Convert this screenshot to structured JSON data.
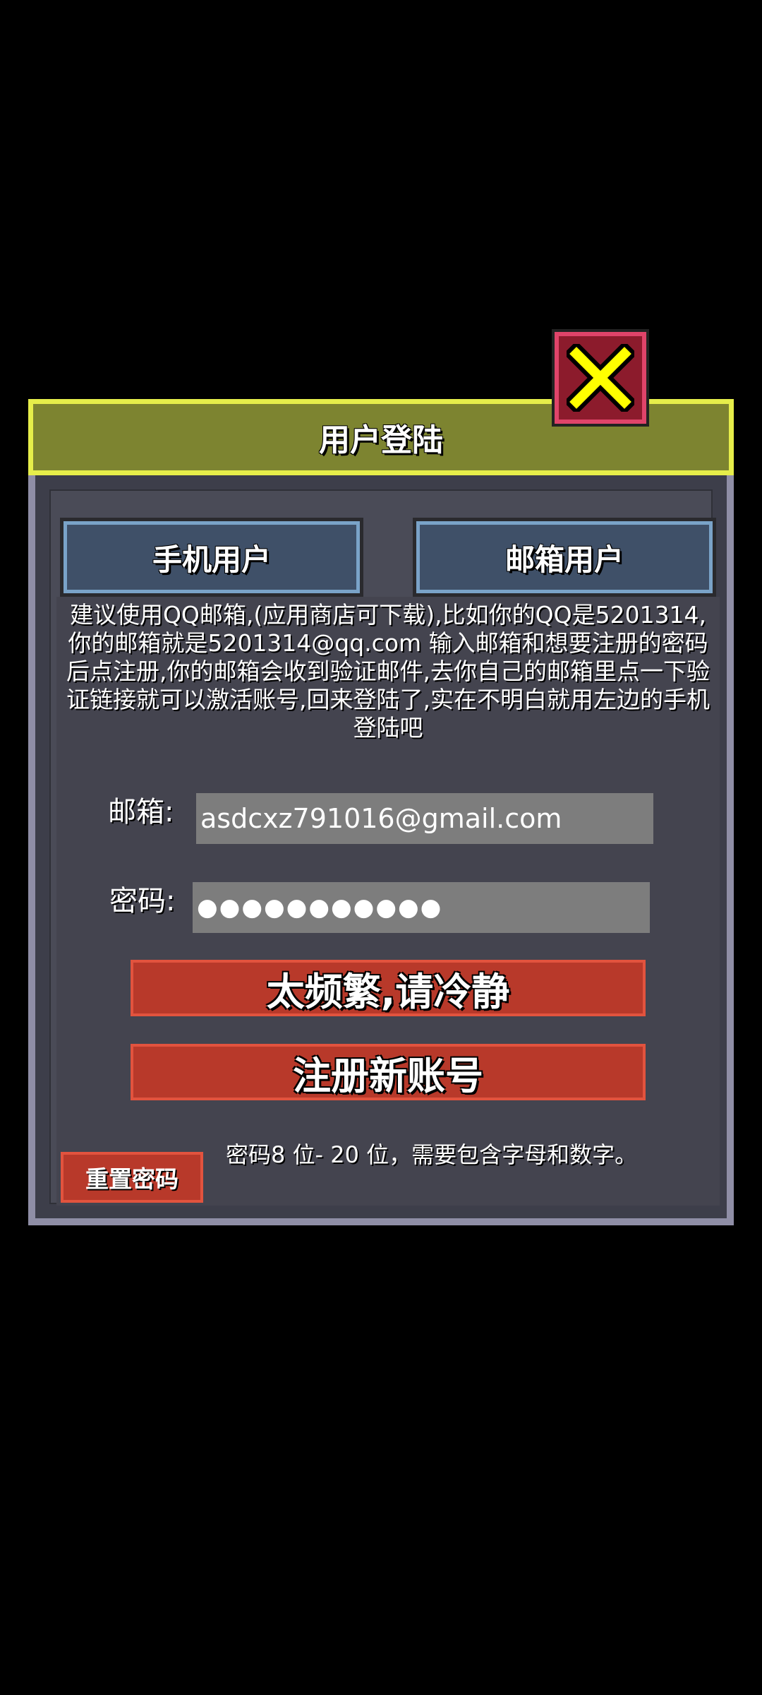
{
  "dialog": {
    "title": "用户登陆",
    "close_icon": "close-x-icon",
    "colors": {
      "title_bg": "#7d8430",
      "title_border": "#e6ee4a",
      "close_bg": "#8c1b2c",
      "close_x": "#ffff00",
      "tab_bg": "#3f5068",
      "button_bg": "#b8392a"
    }
  },
  "tabs": [
    {
      "label": "手机用户"
    },
    {
      "label": "邮箱用户"
    }
  ],
  "hint": "建议使用QQ邮箱,(应用商店可下载),比如你的QQ是5201314,你的邮箱就是5201314@qq.com 输入邮箱和想要注册的密码后点注册,你的邮箱会收到验证邮件,去你自己的邮箱里点一下验证链接就可以激活账号,回来登陆了,实在不明白就用左边的手机登陆吧",
  "form": {
    "email_label": "邮箱:",
    "email_value": "asdcxz791016@gmail.com",
    "password_label": "密码:",
    "password_value": "●●●●●●●●●●●"
  },
  "buttons": {
    "login_label": "太频繁,请冷静",
    "register_label": "注册新账号",
    "reset_label": "重置密码"
  },
  "password_note": "密码8 位- 20 位，需要包含字母和数字。"
}
